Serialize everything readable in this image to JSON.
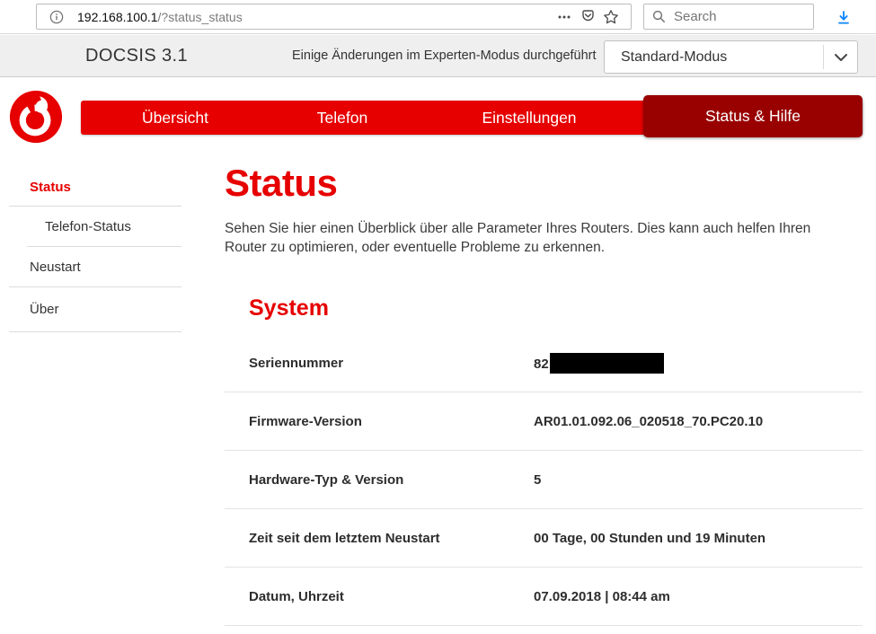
{
  "browser": {
    "url_prefix": "192.168.100.1",
    "url_suffix": "/?status_status",
    "search_placeholder": "Search",
    "icons": {
      "info": "circled-i",
      "page_actions": "three-dots",
      "pocket": "pocket-chevron",
      "bookmark_star": "star-outline",
      "search": "magnifier",
      "download": "blue-down-arrow"
    }
  },
  "header": {
    "brand": "DOCSIS 3.1",
    "notice": "Einige Änderungen im Experten-Modus durchgeführt",
    "mode_selector": {
      "selected": "Standard-Modus",
      "icon": "chevron-down"
    }
  },
  "nav": {
    "tabs": [
      {
        "label": "Übersicht",
        "active": false
      },
      {
        "label": "Telefon",
        "active": false
      },
      {
        "label": "Einstellungen",
        "active": false
      },
      {
        "label": "Status & Hilfe",
        "active": true
      }
    ]
  },
  "sidebar": {
    "items": [
      {
        "label": "Status",
        "active": true,
        "sub": false
      },
      {
        "label": "Telefon-Status",
        "active": false,
        "sub": true
      },
      {
        "label": "Neustart",
        "active": false,
        "sub": false
      },
      {
        "label": "Über",
        "active": false,
        "sub": false
      }
    ]
  },
  "main": {
    "title": "Status",
    "description": "Sehen Sie hier einen Überblick über alle Parameter Ihres Routers. Dies kann auch helfen Ihren Router zu optimieren, oder eventuelle Probleme zu erkennen.",
    "section_title": "System",
    "rows": [
      {
        "label": "Seriennummer",
        "value": "82",
        "redacted": true
      },
      {
        "label": "Firmware-Version",
        "value": "AR01.01.092.06_020518_70.PC20.10",
        "redacted": false
      },
      {
        "label": "Hardware-Typ & Version",
        "value": "5",
        "redacted": false
      },
      {
        "label": "Zeit seit dem letztem Neustart",
        "value": "00 Tage, 00 Stunden und 19 Minuten",
        "redacted": false
      },
      {
        "label": "Datum, Uhrzeit",
        "value": "07.09.2018 | 08:44 am",
        "redacted": false
      }
    ]
  },
  "colors": {
    "vodafone_red": "#e60000",
    "active_tab_red": "#990000",
    "mode_bar_bg": "#efefef",
    "text": "#333333",
    "divider": "#e3e3e3",
    "download_blue": "#0a84ff"
  }
}
